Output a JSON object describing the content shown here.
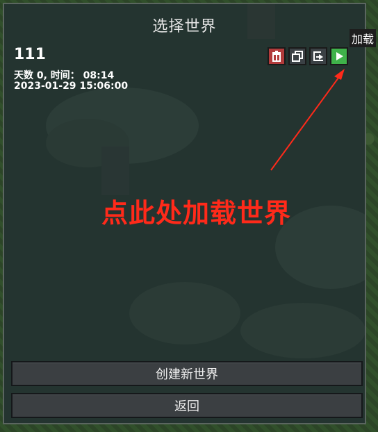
{
  "dialog": {
    "title": "选择世界"
  },
  "world": {
    "name": "111",
    "meta_line1": "天数 0,  时间： 08:14",
    "meta_line2": "2023-01-29 15:06:00"
  },
  "actions": {
    "delete_icon": "trash-icon",
    "copy_icon": "copy-icon",
    "export_icon": "export-icon",
    "play_icon": "play-icon",
    "play_tooltip": "加载"
  },
  "annotation": {
    "text": "点此处加载世界",
    "color": "#ff2a1a"
  },
  "buttons": {
    "create": "创建新世界",
    "back": "返回"
  },
  "colors": {
    "panel": "#243430",
    "delete": "#b23b3b",
    "play": "#3fb24a"
  }
}
